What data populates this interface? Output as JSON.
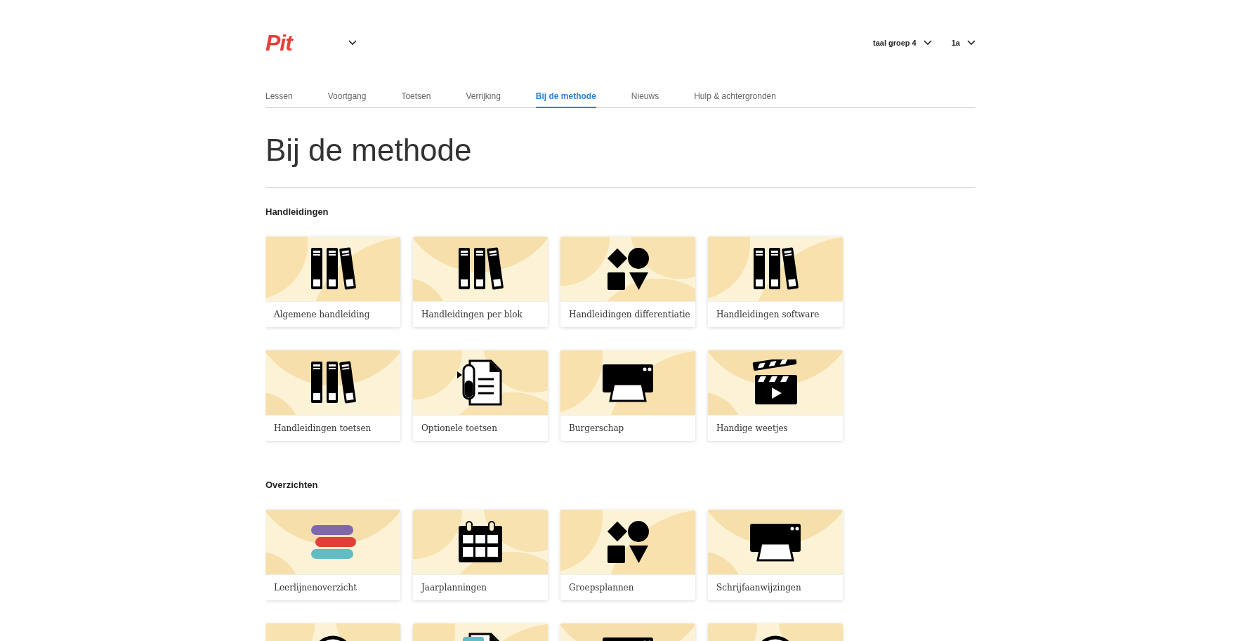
{
  "header": {
    "logo": "Pit",
    "selectors": [
      {
        "label": "taal groep 4"
      },
      {
        "label": "1a"
      }
    ]
  },
  "tabs": [
    {
      "label": "Lessen",
      "selected": false
    },
    {
      "label": "Voortgang",
      "selected": false
    },
    {
      "label": "Toetsen",
      "selected": false
    },
    {
      "label": "Verrijking",
      "selected": false
    },
    {
      "label": "Bij de methode",
      "selected": true
    },
    {
      "label": "Nieuws",
      "selected": false
    },
    {
      "label": "Hulp & achtergronden",
      "selected": false
    }
  ],
  "title": "Bij de methode",
  "sections": [
    {
      "heading": "Handleidingen",
      "cards": [
        {
          "label": "Algemene handleiding",
          "kind": "books"
        },
        {
          "label": "Handleidingen per blok",
          "kind": "books"
        },
        {
          "label": "Handleidingen differentiatie",
          "kind": "shapes"
        },
        {
          "label": "Handleidingen software",
          "kind": "books"
        },
        {
          "label": "Handleidingen toetsen",
          "kind": "books"
        },
        {
          "label": "Optionele toetsen",
          "kind": "document"
        },
        {
          "label": "Burgerschap",
          "kind": "printer"
        },
        {
          "label": "Handige weetjes",
          "kind": "clapper"
        }
      ]
    },
    {
      "heading": "Overzichten",
      "cards": [
        {
          "label": "Leerlijnenoverzicht",
          "kind": "stripes"
        },
        {
          "label": "Jaarplanningen",
          "kind": "calendar"
        },
        {
          "label": "Groepsplannen",
          "kind": "shapes"
        },
        {
          "label": "Schrijfaanwijzingen",
          "kind": "printer"
        },
        {
          "kind": "ring"
        },
        {
          "kind": "document-teal"
        },
        {
          "kind": "printer"
        },
        {
          "kind": "ring"
        }
      ]
    }
  ]
}
